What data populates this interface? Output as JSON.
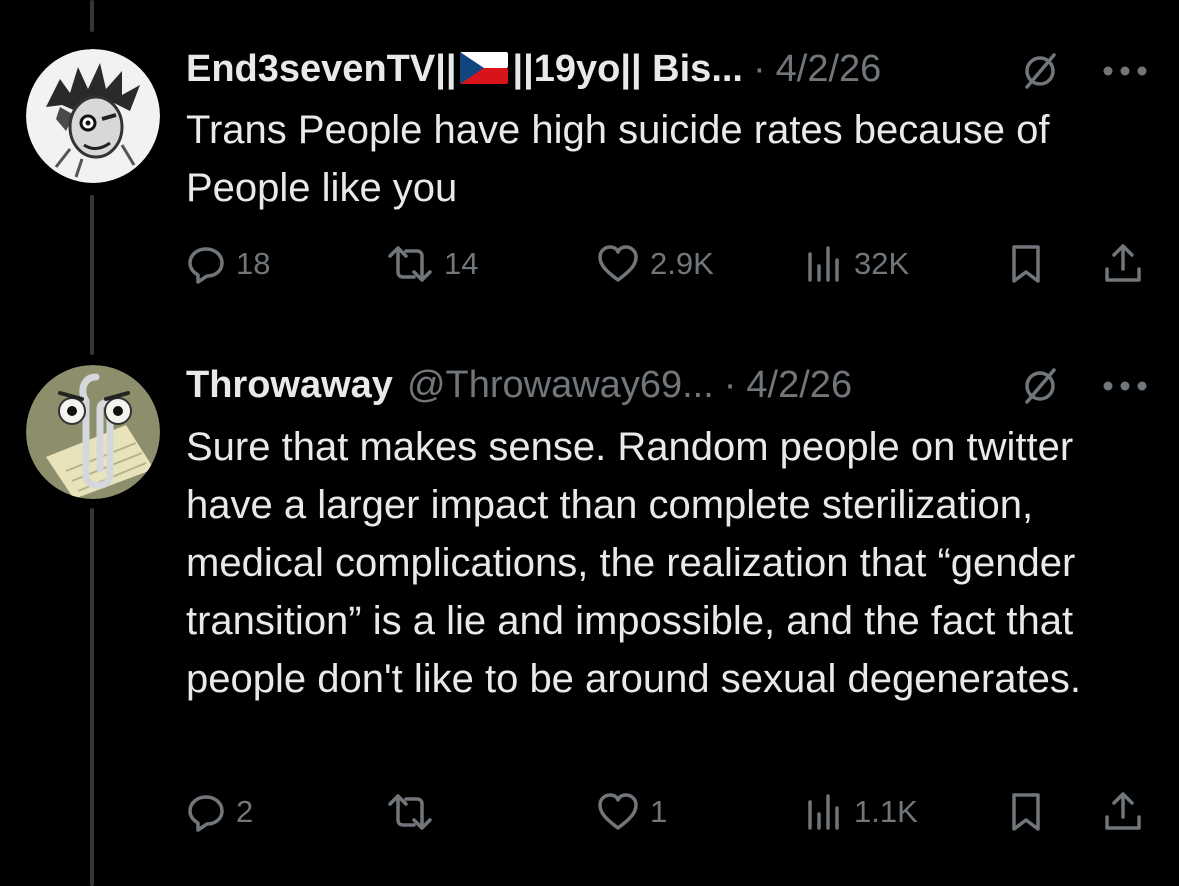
{
  "theme": {
    "background": "#000000",
    "text_primary": "#e7e9ea",
    "text_secondary": "#71767b",
    "thread_line": "#333639"
  },
  "posts": [
    {
      "display_name": "End3sevenTV||",
      "flag_icon": "czech-flag",
      "display_name_suffix": "||19yo|| Bis...",
      "separator": "·",
      "date": "4/2/26",
      "text": "Trans People have high suicide rates because of People like you",
      "replies": "18",
      "reposts": "14",
      "likes": "2.9K",
      "views": "32K"
    },
    {
      "display_name": "Throwaway",
      "handle": "@Throwaway69...",
      "separator": "·",
      "date": "4/2/26",
      "text": "Sure that makes sense. Random people on twitter have a larger impact than complete sterilization, medical complications, the realization that “gender transition” is a lie and impossible, and the fact that people don't like to be around sexual degenerates.",
      "replies": "2",
      "reposts": "",
      "likes": "1",
      "views": "1.1K"
    }
  ]
}
